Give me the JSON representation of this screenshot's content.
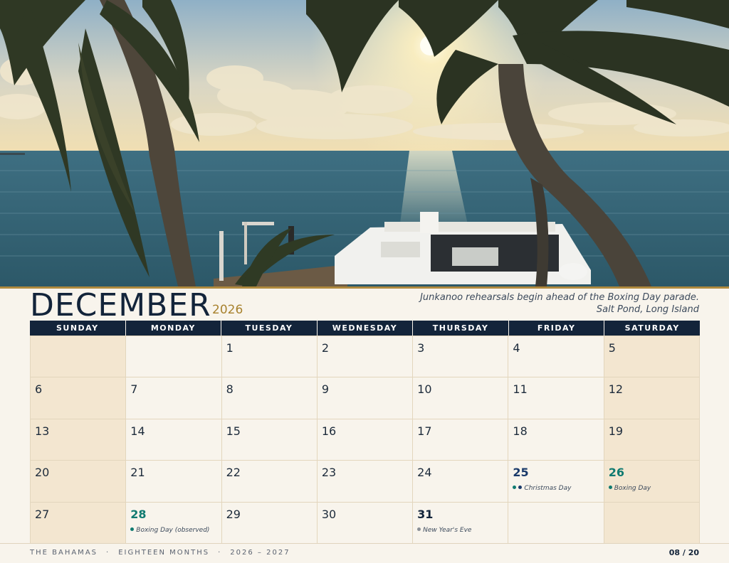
{
  "month": "DECEMBER",
  "year": "2026",
  "caption": {
    "line1": "Junkanoo rehearsals begin ahead of the Boxing Day parade.",
    "line2": "Salt Pond, Long Island"
  },
  "weekdays": [
    "SUNDAY",
    "MONDAY",
    "TUESDAY",
    "WEDNESDAY",
    "THURSDAY",
    "FRIDAY",
    "SATURDAY"
  ],
  "days": [
    "",
    "",
    "1",
    "2",
    "3",
    "4",
    "5",
    "6",
    "7",
    "8",
    "9",
    "10",
    "11",
    "12",
    "13",
    "14",
    "15",
    "16",
    "17",
    "18",
    "19",
    "20",
    "21",
    "22",
    "23",
    "24",
    "25",
    "26",
    "27",
    "28",
    "29",
    "30",
    "31",
    "",
    ""
  ],
  "events": {
    "christmas": "Christmas Day",
    "boxing_day": "Boxing Day",
    "boxing_day_observed": "Boxing Day (observed)",
    "new_years_eve": "New Year's Eve"
  },
  "colors": {
    "navy": "#13243a",
    "teal": "#0f7a70",
    "gold": "#a8822e",
    "weekend": "#f3e6d0"
  },
  "footer": {
    "part1": "THE BAHAMAS",
    "part2": "EIGHTEEN MONTHS",
    "part3": "2026 – 2027",
    "sep": "·",
    "page": "08 / 20"
  }
}
